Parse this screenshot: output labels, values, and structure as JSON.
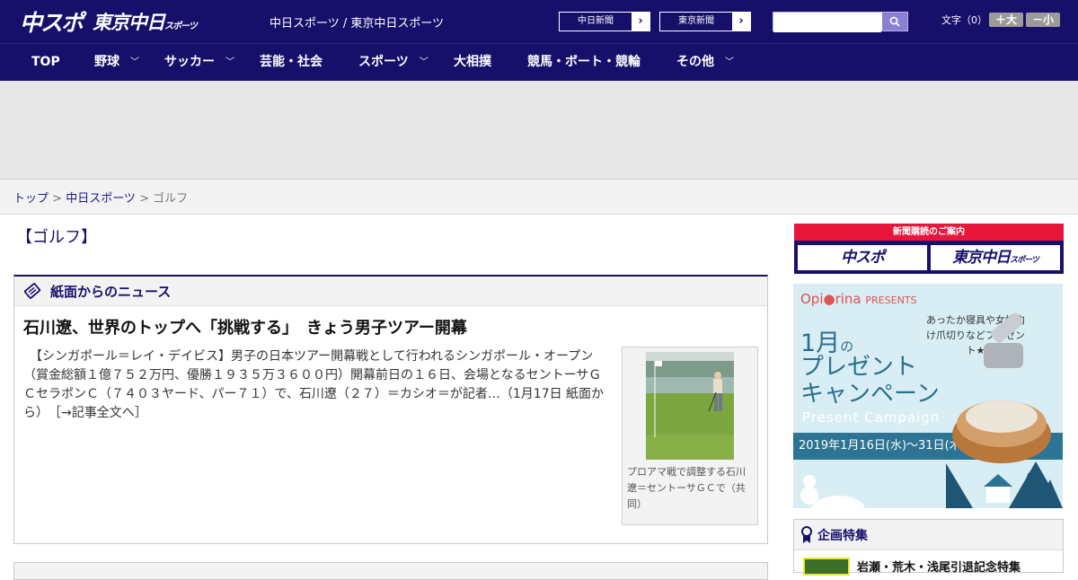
{
  "header": {
    "logo_main": "中スポ",
    "logo_sub": "東京中日",
    "logo_sub_small": "スポーツ",
    "site_links": "中日スポーツ / 東京中日スポーツ",
    "chunichi_label": "中日新聞",
    "tokyo_label": "東京新聞",
    "search_placeholder": "",
    "fontsize_label": "文字（0）",
    "font_larger": "＋大",
    "font_smaller": "－小"
  },
  "nav": {
    "items": [
      {
        "label": "TOP"
      },
      {
        "label": "野球"
      },
      {
        "label": "サッカー"
      },
      {
        "label": "芸能・社会"
      },
      {
        "label": "スポーツ"
      },
      {
        "label": "大相撲"
      },
      {
        "label": "競馬・ボート・競輪"
      },
      {
        "label": "その他"
      }
    ]
  },
  "breadcrumb": {
    "top": "トップ",
    "sep1": " > ",
    "chunichi": "中日スポーツ",
    "sep2": " > ",
    "current": "ゴルフ"
  },
  "main": {
    "heading": "【ゴルフ】",
    "box_title": "紙面からのニュース",
    "article": {
      "title": "石川遼、世界のトップへ「挑戦する」　きょう男子ツアー開幕",
      "body": "　【シンガポール＝レイ・デイビス】男子の日本ツアー開幕戦として行われるシンガポール・オープン（賞金総額１億７５２万円、優勝１９３５万３６００円）開幕前日の１６日、会場となるセントーサＧＣセラポンＣ（７４０３ヤード、パー７１）で、石川遼（２７）＝カシオ＝が記者…（1月17日 紙面から）",
      "more": "［→記事全文へ］",
      "photo_caption": "プロアマ戦で調整する石川遼＝セントーサＧＣで（共同）"
    }
  },
  "sidebar": {
    "subscribe_title": "新聞購読のご案内",
    "subscribe_chuspo": "中スポ",
    "subscribe_tokyo": "東京中日",
    "subscribe_tokyo_small": "スポーツ",
    "promo": {
      "brand": "Opi●rina",
      "brand_suffix": "PRESENTS",
      "copy": "あったか寝具や女性向け爪切りなどプレゼント★",
      "month": "1月",
      "month_suffix": "の",
      "line1": "プレゼント",
      "line2": "キャンペーン",
      "campaign_en": "Present Campaign",
      "dates": "2019年1月16日(水)〜31日(木)"
    },
    "feature_title": "企画特集",
    "feature_item": "岩瀬・荒木・浅尾引退記念特集"
  }
}
